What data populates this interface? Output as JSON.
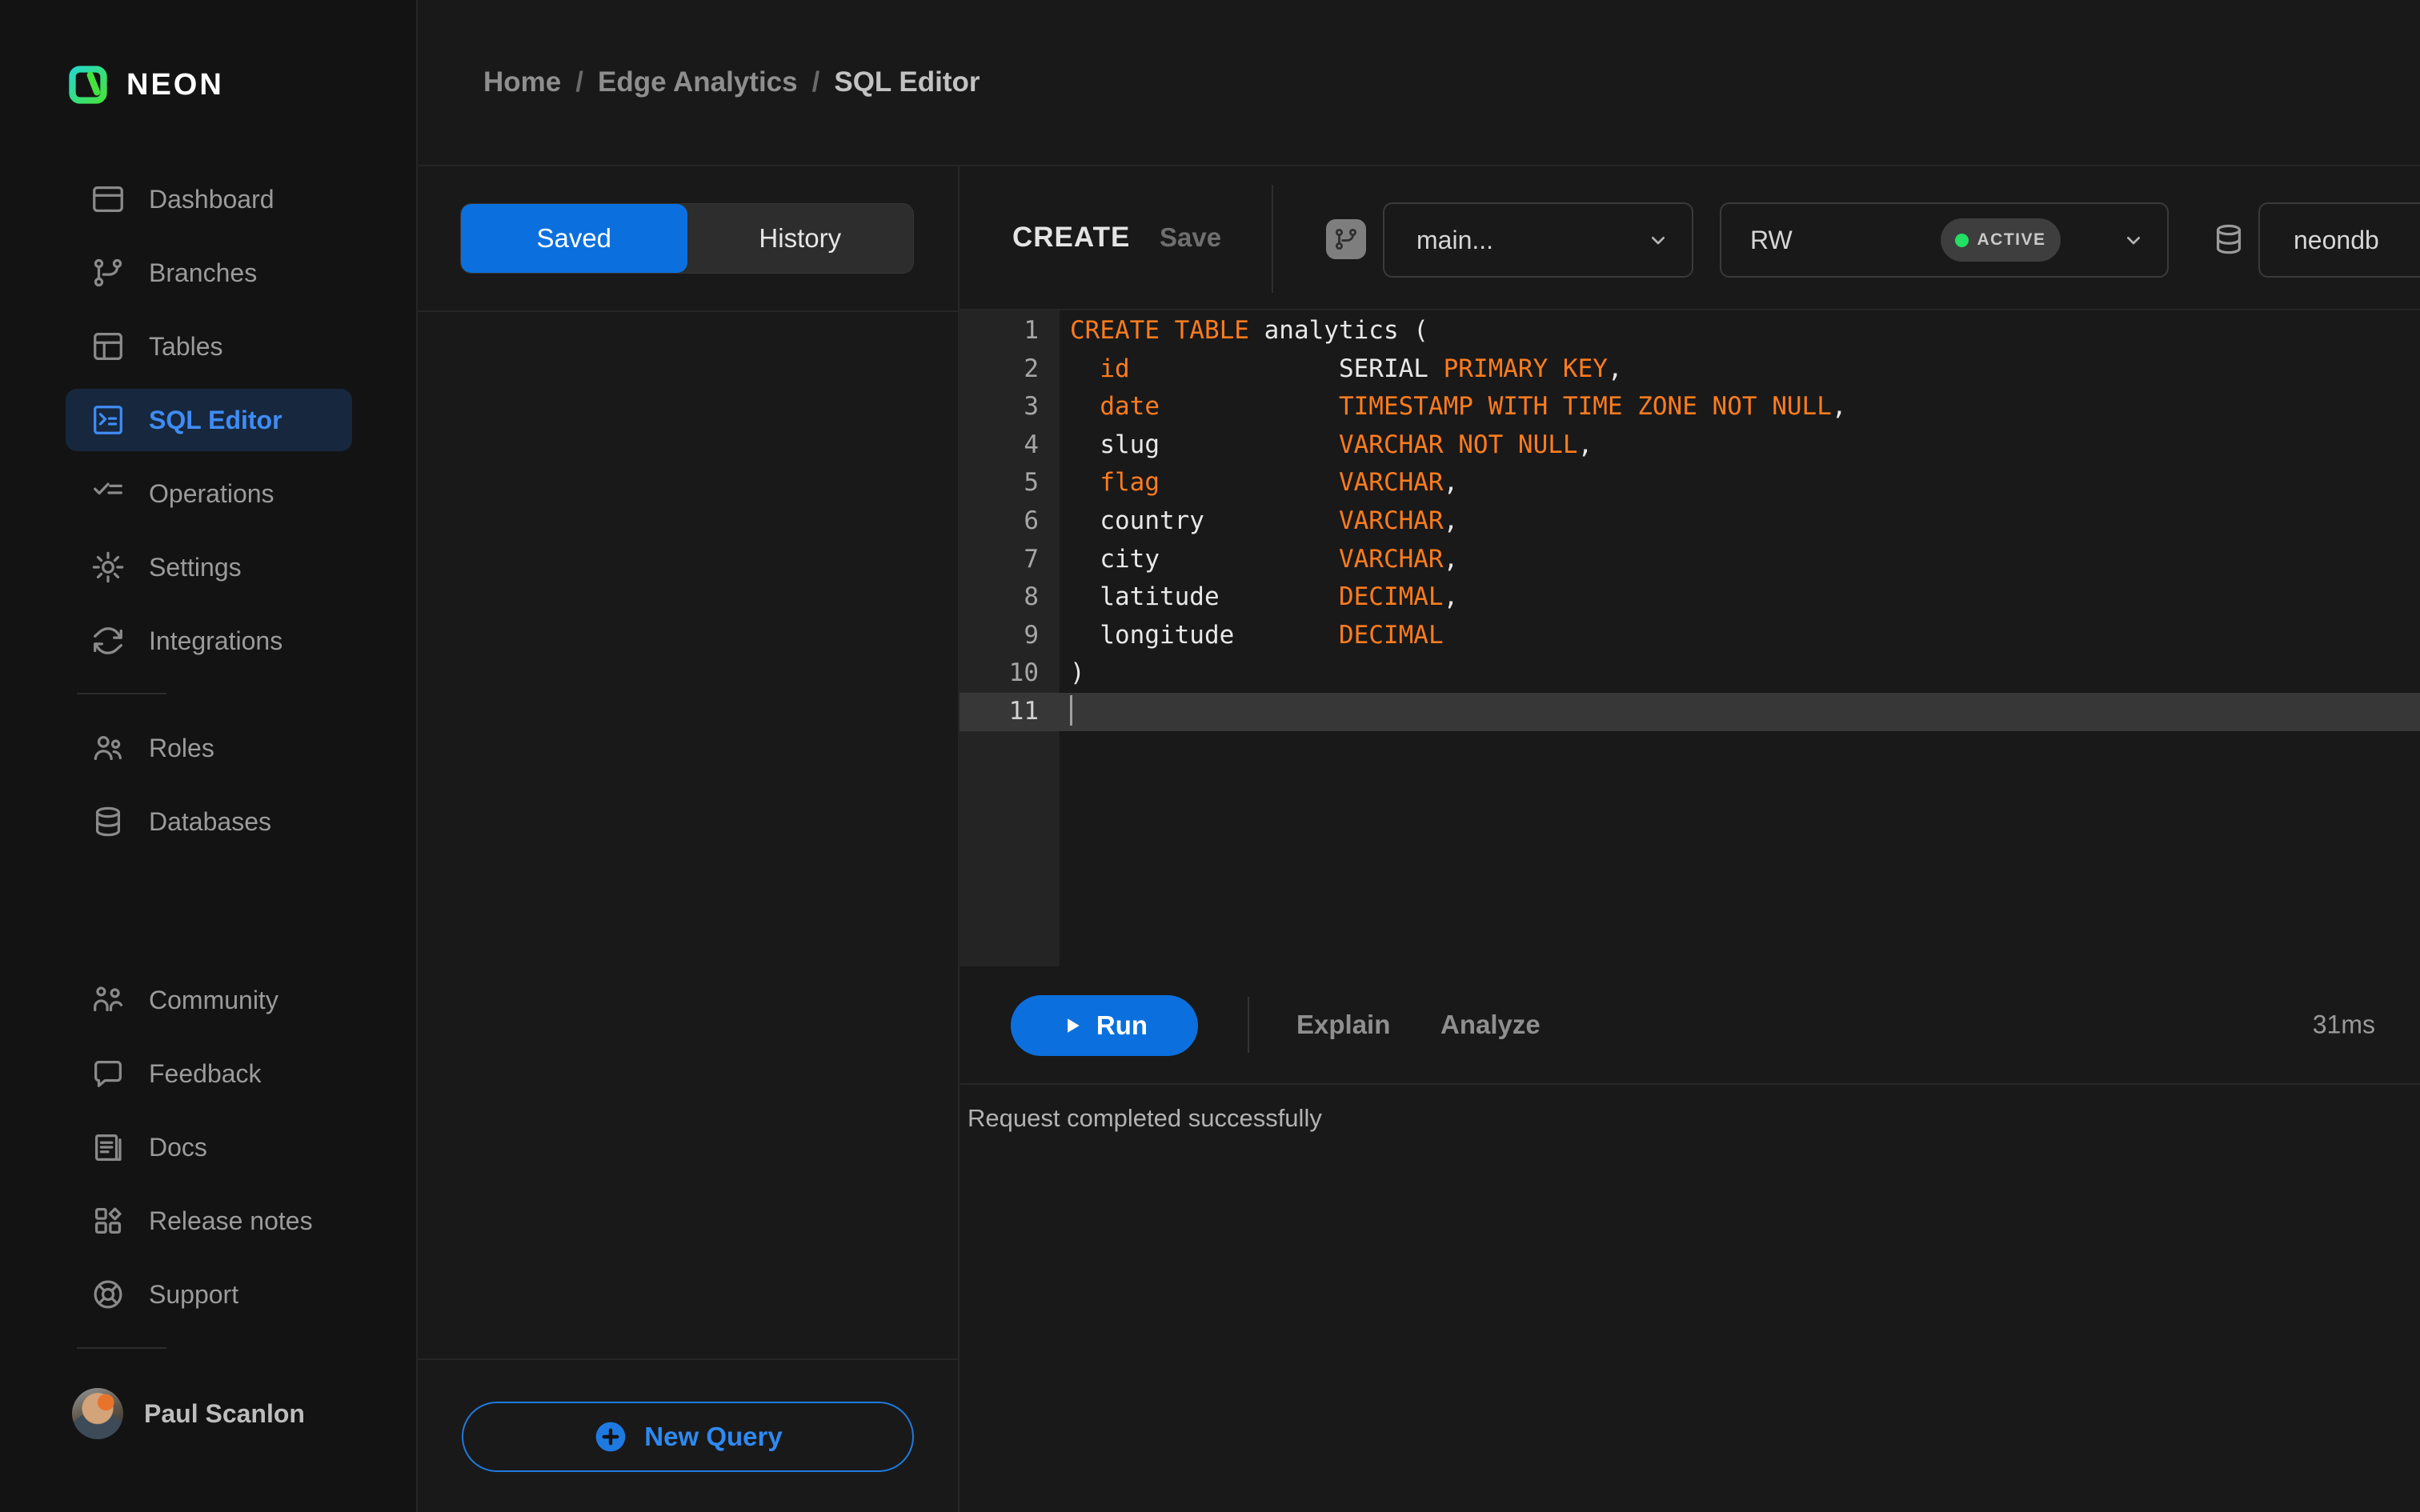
{
  "brand": {
    "name": "NEON"
  },
  "colors": {
    "sidebar_bg": "#131313",
    "bg": "#191919",
    "border": "#262626",
    "accent_blue": "#0b70dd",
    "link_blue": "#3f8cf4",
    "keyword_orange": "#fd7c1e",
    "active_green": "#23df63"
  },
  "sidebar": {
    "items_primary": [
      {
        "label": "Dashboard",
        "icon": "dashboard-icon",
        "active": false
      },
      {
        "label": "Branches",
        "icon": "branches-icon",
        "active": false
      },
      {
        "label": "Tables",
        "icon": "tables-icon",
        "active": false
      },
      {
        "label": "SQL Editor",
        "icon": "sql-editor-icon",
        "active": true
      },
      {
        "label": "Operations",
        "icon": "operations-icon",
        "active": false
      },
      {
        "label": "Settings",
        "icon": "settings-icon",
        "active": false
      },
      {
        "label": "Integrations",
        "icon": "integrations-icon",
        "active": false
      }
    ],
    "items_secondary": [
      {
        "label": "Roles",
        "icon": "roles-icon",
        "active": false
      },
      {
        "label": "Databases",
        "icon": "databases-icon",
        "active": false
      }
    ],
    "items_footer": [
      {
        "label": "Community",
        "icon": "community-icon",
        "active": false
      },
      {
        "label": "Feedback",
        "icon": "feedback-icon",
        "active": false
      },
      {
        "label": "Docs",
        "icon": "docs-icon",
        "active": false
      },
      {
        "label": "Release notes",
        "icon": "release-notes-icon",
        "active": false
      },
      {
        "label": "Support",
        "icon": "support-icon",
        "active": false
      }
    ],
    "user": {
      "name": "Paul Scanlon"
    }
  },
  "breadcrumb": {
    "separator": "/",
    "items": [
      "Home",
      "Edge Analytics",
      "SQL Editor"
    ]
  },
  "query_panel": {
    "tabs": [
      {
        "label": "Saved",
        "active": true
      },
      {
        "label": "History",
        "active": false
      }
    ],
    "new_query_label": "New Query"
  },
  "editor": {
    "toolbar": {
      "title": "CREATE",
      "save_label": "Save",
      "branch_selector": "main...",
      "endpoint": {
        "label": "RW",
        "status": "ACTIVE"
      },
      "database": "neondb"
    },
    "code": {
      "active_line": 11,
      "lines": [
        {
          "num": 1,
          "tokens": [
            [
              "CREATE TABLE",
              "k"
            ],
            [
              " analytics (",
              "p"
            ]
          ]
        },
        {
          "num": 2,
          "tokens": [
            [
              "  ",
              "p"
            ],
            [
              "id",
              "k"
            ],
            [
              "              ",
              "p"
            ],
            [
              "SERIAL ",
              "p"
            ],
            [
              "PRIMARY KEY",
              "k"
            ],
            [
              ",",
              "p"
            ]
          ]
        },
        {
          "num": 3,
          "tokens": [
            [
              "  ",
              "p"
            ],
            [
              "date",
              "k"
            ],
            [
              "            ",
              "p"
            ],
            [
              "TIMESTAMP WITH TIME ZONE NOT NULL",
              "k"
            ],
            [
              ",",
              "p"
            ]
          ]
        },
        {
          "num": 4,
          "tokens": [
            [
              "  slug",
              "p"
            ],
            [
              "            ",
              "p"
            ],
            [
              "VARCHAR NOT NULL",
              "k"
            ],
            [
              ",",
              "p"
            ]
          ]
        },
        {
          "num": 5,
          "tokens": [
            [
              "  ",
              "p"
            ],
            [
              "flag",
              "k"
            ],
            [
              "            ",
              "p"
            ],
            [
              "VARCHAR",
              "k"
            ],
            [
              ",",
              "p"
            ]
          ]
        },
        {
          "num": 6,
          "tokens": [
            [
              "  country",
              "p"
            ],
            [
              "         ",
              "p"
            ],
            [
              "VARCHAR",
              "k"
            ],
            [
              ",",
              "p"
            ]
          ]
        },
        {
          "num": 7,
          "tokens": [
            [
              "  city",
              "p"
            ],
            [
              "            ",
              "p"
            ],
            [
              "VARCHAR",
              "k"
            ],
            [
              ",",
              "p"
            ]
          ]
        },
        {
          "num": 8,
          "tokens": [
            [
              "  latitude",
              "p"
            ],
            [
              "        ",
              "p"
            ],
            [
              "DECIMAL",
              "k"
            ],
            [
              ",",
              "p"
            ]
          ]
        },
        {
          "num": 9,
          "tokens": [
            [
              "  longitude",
              "p"
            ],
            [
              "       ",
              "p"
            ],
            [
              "DECIMAL",
              "k"
            ]
          ]
        },
        {
          "num": 10,
          "tokens": [
            [
              ")",
              "p"
            ]
          ]
        },
        {
          "num": 11,
          "tokens": []
        }
      ]
    },
    "run_bar": {
      "run_label": "Run",
      "explain_label": "Explain",
      "analyze_label": "Analyze",
      "duration": "31ms"
    },
    "status_message": "Request completed successfully"
  }
}
